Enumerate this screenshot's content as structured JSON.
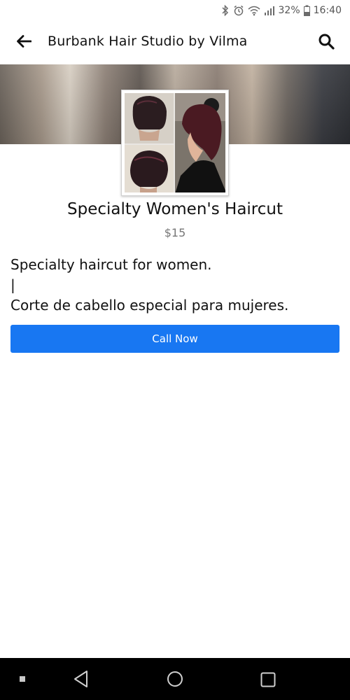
{
  "status_bar": {
    "battery": "32%",
    "time": "16:40",
    "icons": [
      "bluetooth-icon",
      "alarm-icon",
      "wifi-icon",
      "signal-icon",
      "battery-icon"
    ]
  },
  "app_bar": {
    "title": "Burbank Hair Studio by Vilma",
    "back_icon": "arrow-left-icon",
    "search_icon": "search-icon"
  },
  "product": {
    "title": "Specialty Women's Haircut",
    "price": "$15",
    "description_lines": [
      "Specialty haircut for women.",
      "|",
      "Corte de cabello especial para mujeres."
    ]
  },
  "actions": {
    "call_label": "Call Now"
  },
  "colors": {
    "accent": "#1877f2",
    "nav_bar": "#000000"
  },
  "nav_bar": {
    "icons": [
      "menu-dot-icon",
      "back-triangle-icon",
      "home-circle-icon",
      "recents-square-icon"
    ]
  }
}
